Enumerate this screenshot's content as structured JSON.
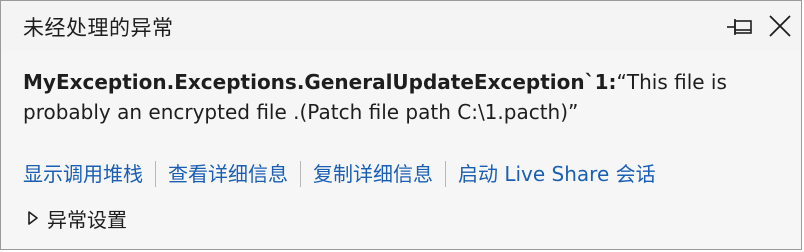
{
  "window": {
    "title": "未经处理的异常"
  },
  "exception": {
    "type": "MyException.Exceptions.GeneralUpdateException`1:",
    "message": "“This file is probably an encrypted file .(Patch file path C:\\1.pacth)”"
  },
  "actions": [
    {
      "label": "显示调用堆栈"
    },
    {
      "label": "查看详细信息"
    },
    {
      "label": "复制详细信息"
    },
    {
      "label": "启动 Live Share 会话"
    }
  ],
  "settings": {
    "label": "异常设置",
    "expanded": false
  },
  "colors": {
    "link": "#1a5fb4",
    "text": "#1e1e1e",
    "background": "#f6f6f6"
  },
  "icons": {
    "pin": "pin-icon",
    "close": "close-icon",
    "expand": "triangle-right-icon"
  }
}
